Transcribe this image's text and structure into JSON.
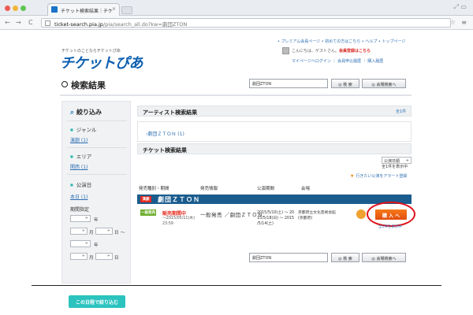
{
  "browser": {
    "tab_title": "チケット検索結果｜チケ",
    "tab_close": "×",
    "url_prefix": "ticket-search.pia.jp",
    "url_rest": "/pia/search_all.do?kw=劇団ZTON",
    "window_controls": "⤢ ▭",
    "back": "←",
    "forward": "→",
    "reload": "C",
    "bookmark": "☆",
    "menu": "≡"
  },
  "header": {
    "toplinks": "• プレミアム会員ページ • 初めての方はこちら • ヘルプ • トップページ",
    "tagline": "チケットのことならチケットぴあ",
    "logo": "チケットぴあ",
    "guest_text_a": "こんにちは、ゲストさん。",
    "guest_text_b": "会員登録はこちら",
    "guest_links": "マイページへログイン ｜ 会員申込履歴 ｜ 購入履歴"
  },
  "main": {
    "results_title": "検索結果",
    "search": {
      "value": "劇団ZTON",
      "search_label": "◎ 検 索",
      "detail_label": "◎ 会場検索へ"
    }
  },
  "sidebar": {
    "title": "絞り込み",
    "genre_label": "ジャンル",
    "genre_link": "演劇 (1)",
    "area_label": "エリア",
    "area_link": "関西 (1)",
    "date_label": "公演日",
    "date_link": "本日 (1)",
    "period_label": "期間指定",
    "year": "年",
    "month": "月",
    "day": "日",
    "tilde": "～",
    "select_arrow": "÷",
    "submit_label": "この日程で絞り込む"
  },
  "artist_section": {
    "title": "アーティスト検索結果",
    "count": "全1件",
    "link": "›劇団ＺＴＯＮ (1)"
  },
  "ticket_section": {
    "title": "チケット検索結果",
    "sort": "公演日順",
    "sort_arrow": "÷",
    "showing": "全1件を表示中",
    "alert": "行きたい公演をアラート登録",
    "columns": {
      "type": "発売種別・期間",
      "info": "発売情報",
      "period": "公演期間",
      "venue": "会場"
    },
    "performance": {
      "badge": "演劇",
      "name": "劇団ＺＴＯＮ"
    },
    "row": {
      "type_badge": "一般発売",
      "status": "販売期間中",
      "dates_1": "～2015/05/11(木)",
      "dates_2": "23:59",
      "info": "一般発売 ／劇団ＺＴＯＮ",
      "period_1": "2015/5/10(土) ～ 20",
      "period_2": "15/5/18(日) ～ 2015",
      "period_3": "/5/14(土)",
      "venue_1": "京都府立文化芸術会館",
      "venue_2": "(京都府)",
      "buy_label": "購 入 へ",
      "note": "全1件を表示中"
    }
  }
}
